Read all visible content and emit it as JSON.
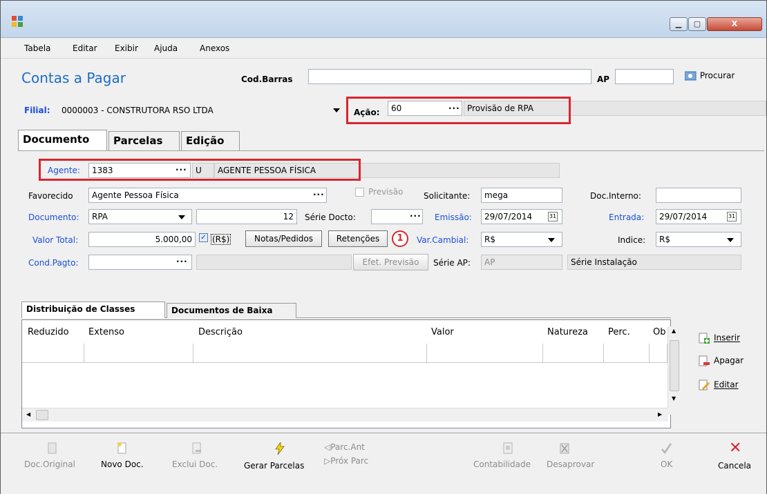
{
  "window": {
    "minimize": "▁",
    "maximize": "▢",
    "close": "X"
  },
  "menu": [
    {
      "label": "Tabela"
    },
    {
      "label": "Editar"
    },
    {
      "label": "Exibir"
    },
    {
      "label": "Ajuda"
    },
    {
      "label": "Anexos"
    }
  ],
  "header": {
    "title": "Contas a Pagar",
    "codbarras_label": "Cod.Barras",
    "codbarras_value": "",
    "ap_label": "AP",
    "ap_value": "",
    "search_label": "Procurar",
    "filial_label": "Filial:",
    "filial_value": "0000003 - CONSTRUTORA RSO LTDA",
    "acao_label": "Ação:",
    "acao_value": "60",
    "acao_desc": "Provisão de RPA"
  },
  "tabs": [
    "Documento",
    "Parcelas",
    "Edição"
  ],
  "form": {
    "agente_label": "Agente:",
    "agente_value": "1383",
    "agente_type": "U",
    "agente_name": "AGENTE PESSOA FÍSICA",
    "favorecido_label": "Favorecido",
    "favorecido_value": "Agente Pessoa Física",
    "previsao_label": "Previsão",
    "solicitante_label": "Solicitante:",
    "solicitante_value": "mega",
    "docinterno_label": "Doc.Interno:",
    "docinterno_value": "",
    "documento_label": "Documento:",
    "documento_value": "RPA",
    "documento_num": "12",
    "seriedocto_label": "Série Docto:",
    "seriedocto_value": "",
    "emissao_label": "Emissão:",
    "emissao_value": "29/07/2014",
    "entrada_label": "Entrada:",
    "entrada_value": "29/07/2014",
    "valortotal_label": "Valor Total:",
    "valortotal_value": "5.000,00",
    "moeda_check_label": "(R$)",
    "notas_button": "Notas/Pedidos",
    "retencoes_button": "Retenções",
    "marker": "1",
    "varcambial_label": "Var.Cambial:",
    "varcambial_value": "R$",
    "indice_label": "Indice:",
    "indice_value": "R$",
    "condpagto_label": "Cond.Pagto:",
    "condpagto_value": "",
    "efet_button": "Efet. Previsão",
    "serieap_label": "Série AP:",
    "serieap_value": "AP",
    "serieinst_value": "Série Instalação"
  },
  "subtabs": [
    "Distribuição de Classes",
    "Documentos de Baixa"
  ],
  "grid": {
    "columns": [
      "Reduzido",
      "Extenso",
      "Descrição",
      "Valor",
      "Natureza",
      "Perc.",
      "Ob"
    ]
  },
  "side": {
    "insert": "Inserir",
    "delete": "Apagar",
    "edit": "Editar"
  },
  "toolbar": {
    "doc_original": "Doc.Original",
    "novo_doc": "Novo Doc.",
    "exclui_doc": "Exclui Doc.",
    "gerar_parcelas": "Gerar Parcelas",
    "parc_ant": "Parc.Ant",
    "prox_parc": "Próx Parc",
    "contabilidade": "Contabilidade",
    "desaprovar": "Desaprovar",
    "ok": "OK",
    "cancela": "Cancela"
  },
  "colors": {
    "accent": "#1c6cc4",
    "highlight": "#d7262e",
    "label_blue": "#1a4fd6"
  }
}
